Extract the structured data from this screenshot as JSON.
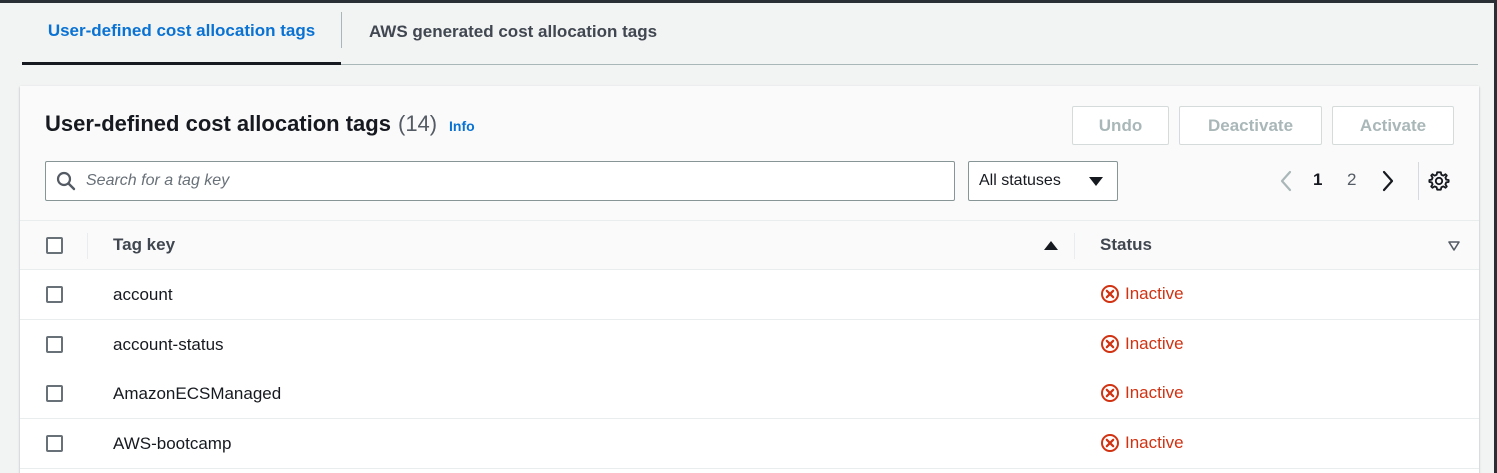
{
  "tabs": [
    {
      "label": "User-defined cost allocation tags",
      "active": true
    },
    {
      "label": "AWS generated cost allocation tags",
      "active": false
    }
  ],
  "panel": {
    "title": "User-defined cost allocation tags",
    "count": "(14)",
    "info_label": "Info"
  },
  "actions": {
    "undo": "Undo",
    "deactivate": "Deactivate",
    "activate": "Activate"
  },
  "search": {
    "placeholder": "Search for a tag key",
    "value": ""
  },
  "status_filter": {
    "selected": "All statuses"
  },
  "pagination": {
    "current_page": "1",
    "other_page": "2"
  },
  "table": {
    "columns": [
      "Tag key",
      "Status"
    ],
    "rows": [
      {
        "key": "account",
        "status": "Inactive"
      },
      {
        "key": "account-status",
        "status": "Inactive"
      },
      {
        "key": "AmazonECSManaged",
        "status": "Inactive"
      },
      {
        "key": "AWS-bootcamp",
        "status": "Inactive"
      }
    ]
  },
  "colors": {
    "accent": "#0972d3",
    "inactive": "#d13212",
    "disabled_text": "#aab7b8"
  },
  "icons": {
    "search": "search-icon",
    "caret": "caret-down-icon",
    "prev": "chevron-left-icon",
    "next": "chevron-right-icon",
    "settings": "gear-icon",
    "status": "status-negative-icon",
    "sort_asc": "sort-ascending-icon",
    "sort_desc": "sort-descending-icon"
  }
}
